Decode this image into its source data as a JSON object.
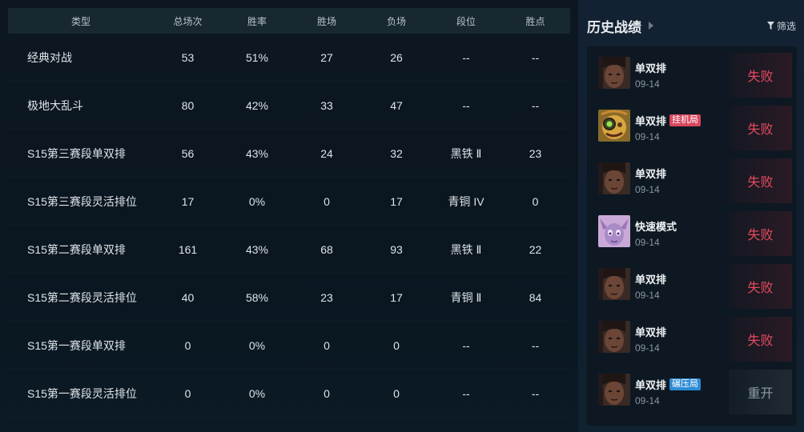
{
  "stats": {
    "headers": [
      "类型",
      "总场次",
      "胜率",
      "胜场",
      "负场",
      "段位",
      "胜点"
    ],
    "rows": [
      [
        "经典对战",
        "53",
        "51%",
        "27",
        "26",
        "--",
        "--"
      ],
      [
        "极地大乱斗",
        "80",
        "42%",
        "33",
        "47",
        "--",
        "--"
      ],
      [
        "S15第三赛段单双排",
        "56",
        "43%",
        "24",
        "32",
        "黑铁 Ⅱ",
        "23"
      ],
      [
        "S15第三赛段灵活排位",
        "17",
        "0%",
        "0",
        "17",
        "青铜 IV",
        "0"
      ],
      [
        "S15第二赛段单双排",
        "161",
        "43%",
        "68",
        "93",
        "黑铁 Ⅱ",
        "22"
      ],
      [
        "S15第二赛段灵活排位",
        "40",
        "58%",
        "23",
        "17",
        "青铜 Ⅱ",
        "84"
      ],
      [
        "S15第一赛段单双排",
        "0",
        "0%",
        "0",
        "0",
        "--",
        "--"
      ],
      [
        "S15第一赛段灵活排位",
        "0",
        "0%",
        "0",
        "0",
        "--",
        "--"
      ]
    ]
  },
  "history": {
    "title": "历史战绩",
    "filter_label": "筛选",
    "matches": [
      {
        "mode": "单双排",
        "tag": "",
        "date": "09-14",
        "result": "失败",
        "avatar": "dark-champion-portrait"
      },
      {
        "mode": "单双排",
        "tag": "挂机局",
        "date": "09-14",
        "result": "失败",
        "avatar": "gold-goggles-champion-portrait"
      },
      {
        "mode": "单双排",
        "tag": "",
        "date": "09-14",
        "result": "失败",
        "avatar": "dark-champion-portrait"
      },
      {
        "mode": "快速模式",
        "tag": "",
        "date": "09-14",
        "result": "失败",
        "avatar": "purple-champion-portrait"
      },
      {
        "mode": "单双排",
        "tag": "",
        "date": "09-14",
        "result": "失败",
        "avatar": "dark-champion-portrait"
      },
      {
        "mode": "单双排",
        "tag": "",
        "date": "09-14",
        "result": "失败",
        "avatar": "dark-champion-portrait"
      },
      {
        "mode": "单双排",
        "tag": "碾压局",
        "date": "09-14",
        "result": "重开",
        "avatar": "dark-champion-portrait"
      }
    ]
  },
  "colors": {
    "lose": "#e44a5f",
    "remake": "#8d9aa4",
    "tag_red": "#d9475e",
    "tag_blue": "#2d8bd6"
  }
}
